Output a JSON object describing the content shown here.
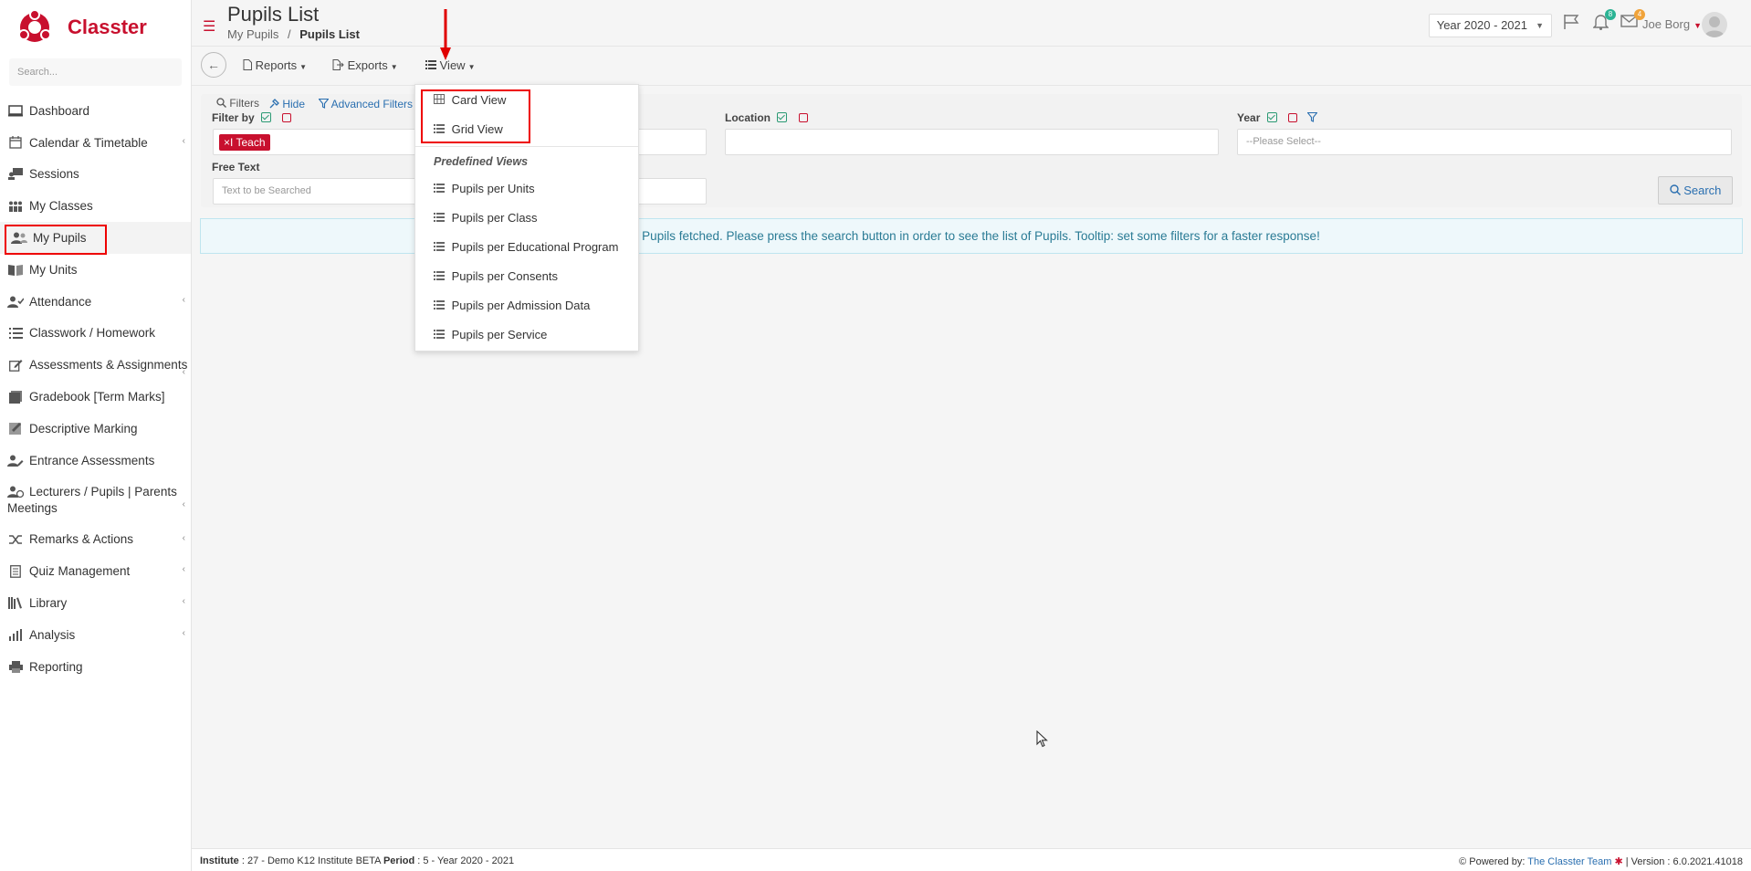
{
  "sidebar": {
    "brand": "Classter",
    "search_placeholder": "Search...",
    "items": [
      {
        "label": "Dashboard",
        "icon": "monitor-icon"
      },
      {
        "label": "Calendar & Timetable",
        "icon": "calendar-icon"
      },
      {
        "label": "Sessions",
        "icon": "sessions-icon"
      },
      {
        "label": "My Classes",
        "icon": "classes-icon"
      },
      {
        "label": "My Pupils",
        "icon": "pupils-icon"
      },
      {
        "label": "My Units",
        "icon": "book-icon"
      },
      {
        "label": "Attendance",
        "icon": "user-check-icon"
      },
      {
        "label": "Classwork / Homework",
        "icon": "list-icon"
      },
      {
        "label": "Assessments & Assignments",
        "icon": "edit-icon"
      },
      {
        "label": "Gradebook [Term Marks]",
        "icon": "gradebook-icon"
      },
      {
        "label": "Descriptive Marking",
        "icon": "marking-icon"
      },
      {
        "label": "Entrance Assessments",
        "icon": "user-edit-icon"
      },
      {
        "label": "Lecturers / Pupils | Parents Meetings",
        "icon": "meetings-icon"
      },
      {
        "label": "Remarks & Actions",
        "icon": "shuffle-icon"
      },
      {
        "label": "Quiz Management",
        "icon": "quiz-icon"
      },
      {
        "label": "Library",
        "icon": "library-icon"
      },
      {
        "label": "Analysis",
        "icon": "chart-icon"
      },
      {
        "label": "Reporting",
        "icon": "printer-icon"
      }
    ]
  },
  "header": {
    "title": "Pupils List",
    "breadcrumb_parent": "My Pupils",
    "breadcrumb_sep": "/",
    "breadcrumb_current": "Pupils List",
    "year_select": "Year 2020 - 2021",
    "notifications_count": "8",
    "messages_count": "4",
    "user_name": "Joe Borg"
  },
  "toolbar": {
    "reports": "Reports",
    "exports": "Exports",
    "view": "View"
  },
  "filters": {
    "filters_label": "Filters",
    "hide_label": "Hide",
    "advanced_label": "Advanced Filters",
    "filter_by_label": "Filter by",
    "tag_label": "I Teach",
    "location_label": "Location",
    "year_label": "Year",
    "year_placeholder": "--Please Select--",
    "free_text_label": "Free Text",
    "free_text_placeholder": "Text to be Searched",
    "search_button": "Search"
  },
  "info_message": "No Pupils fetched. Please press the search button in order to see the list of Pupils. Tooltip: set some filters for a faster response!",
  "view_menu": {
    "card_view": "Card View",
    "grid_view": "Grid View",
    "predefined_header": "Predefined Views",
    "predefined": [
      "Pupils per Units",
      "Pupils per Class",
      "Pupils per Educational Program",
      "Pupils per Consents",
      "Pupils per Admission Data",
      "Pupils per Service"
    ]
  },
  "footer": {
    "institute_label": "Institute",
    "institute_value": ": 27 - Demo K12 Institute BETA",
    "period_label": "Period",
    "period_value": ": 5 - Year 2020 - 2021",
    "powered_by": "Powered by:",
    "team_link": "The Classter Team",
    "version": "| Version : 6.0.2021.41018"
  },
  "colors": {
    "brand": "#c8102e",
    "link": "#2a6fb0",
    "check": "#2b9a74",
    "annotation": "#e00000"
  }
}
